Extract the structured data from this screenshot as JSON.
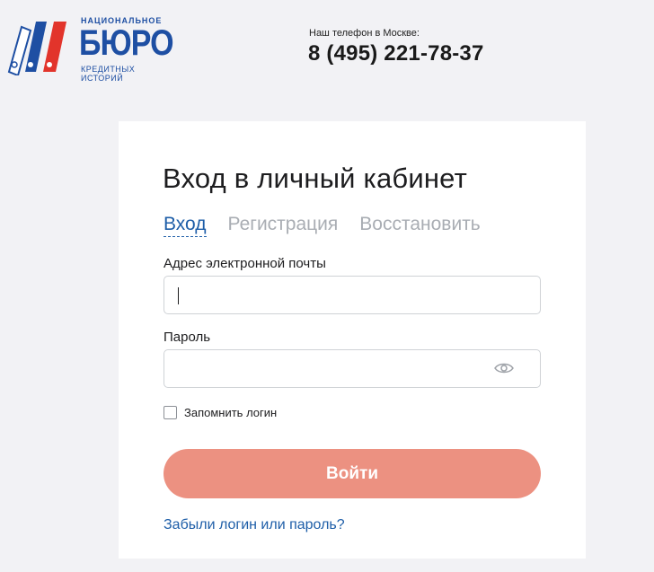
{
  "header": {
    "logo": {
      "top_text": "НАЦИОНАЛЬНОЕ",
      "main_text": "БЮРО",
      "bottom_text": "КРЕДИТНЫХ ИСТОРИЙ"
    },
    "phone_label": "Наш телефон в Москве:",
    "phone_number": "8 (495) 221-78-37"
  },
  "login": {
    "title": "Вход в личный кабинет",
    "tabs": [
      {
        "label": "Вход",
        "active": true
      },
      {
        "label": "Регистрация",
        "active": false
      },
      {
        "label": "Восстановить",
        "active": false
      }
    ],
    "email_label": "Адрес электронной почты",
    "email_value": "",
    "password_label": "Пароль",
    "password_value": "",
    "show_password_icon": "eye-icon",
    "remember_label": "Запомнить логин",
    "remember_checked": false,
    "submit_label": "Войти",
    "forgot_link": "Забыли логин или пароль?"
  },
  "colors": {
    "background": "#f2f2f5",
    "brand_blue": "#1e4fa3",
    "link_blue": "#1e5ea8",
    "button": "#ec9181",
    "inactive_tab": "#a9adb3"
  }
}
